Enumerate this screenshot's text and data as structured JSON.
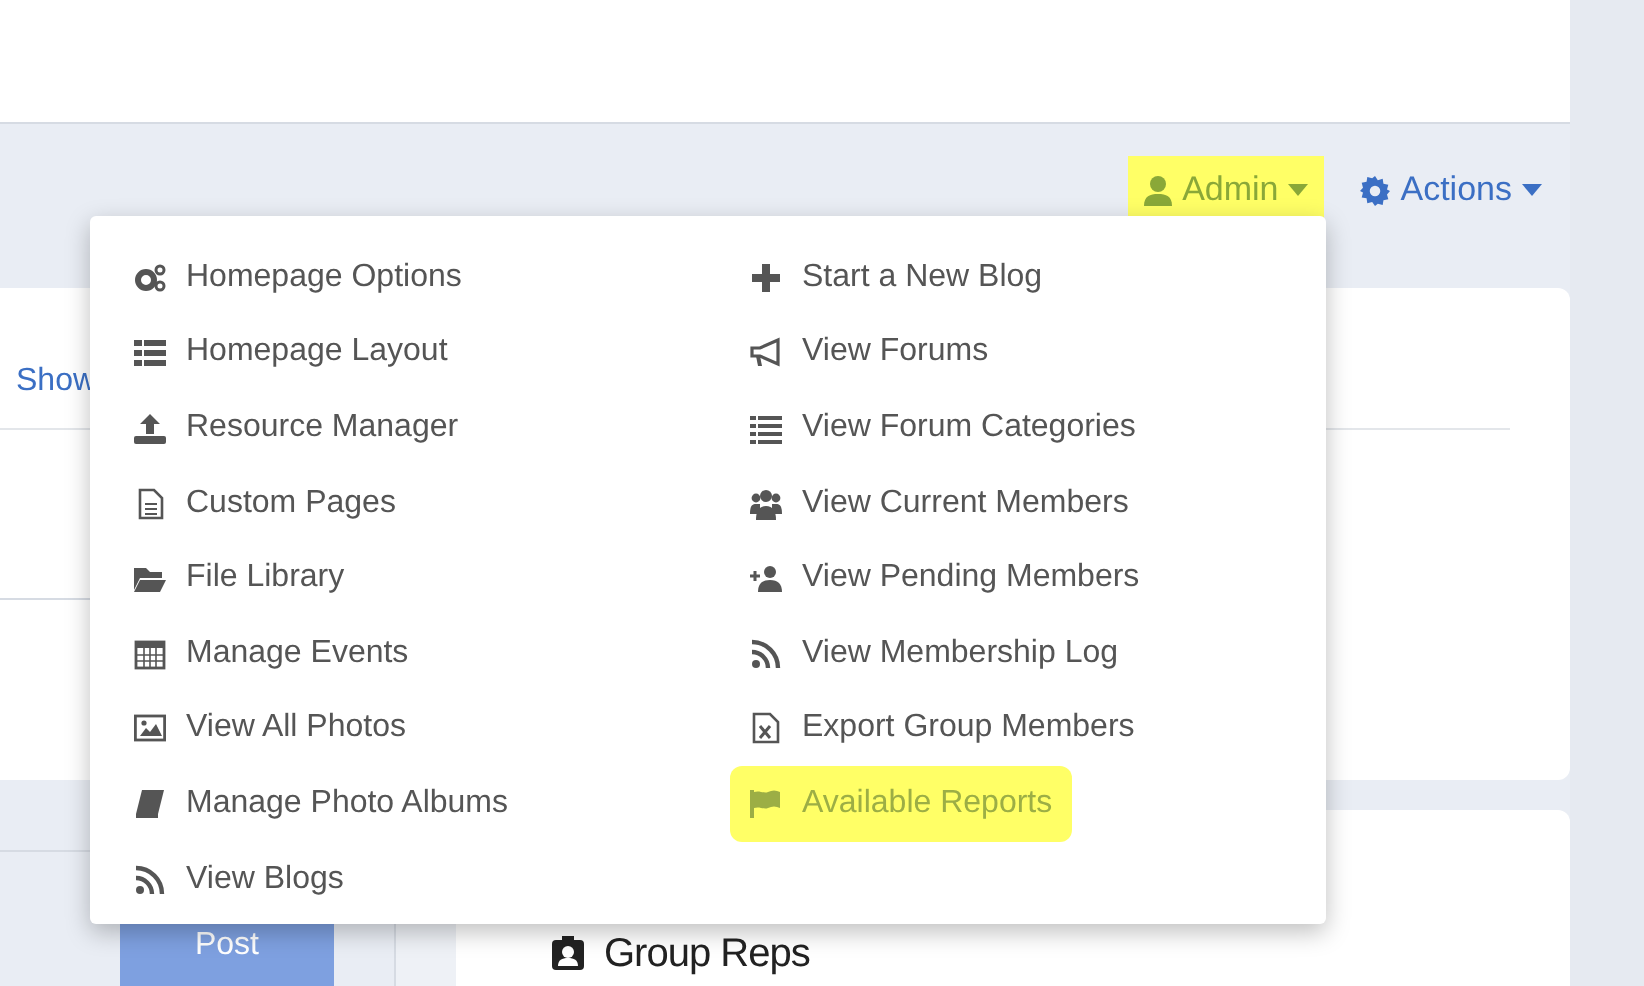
{
  "nav": [
    {
      "kind": "admin",
      "label": "Admin",
      "highlighted": true
    },
    {
      "kind": "actions",
      "label": "Actions",
      "highlighted": false
    }
  ],
  "card": {
    "link": "Show"
  },
  "post_button": "Post",
  "group_reps": {
    "title": "Group Reps"
  },
  "admin_menu": {
    "columns": [
      [
        {
          "label": "Homepage Options",
          "highlighted": false
        },
        {
          "label": "Homepage Layout",
          "highlighted": false
        },
        {
          "label": "Resource Manager",
          "highlighted": false
        },
        {
          "label": "Custom Pages",
          "highlighted": false
        },
        {
          "label": "File Library",
          "highlighted": false
        },
        {
          "label": "Manage Events",
          "highlighted": false
        },
        {
          "label": "View All Photos",
          "highlighted": false
        },
        {
          "label": "Manage Photo Albums",
          "highlighted": false
        },
        {
          "label": "View Blogs",
          "highlighted": false
        }
      ],
      [
        {
          "label": "Start a New Blog",
          "highlighted": false
        },
        {
          "label": "View Forums",
          "highlighted": false
        },
        {
          "label": "View Forum Categories",
          "highlighted": false
        },
        {
          "label": "View Current Members",
          "highlighted": false
        },
        {
          "label": "View Pending Members",
          "highlighted": false
        },
        {
          "label": "View Membership Log",
          "highlighted": false
        },
        {
          "label": "Export Group Members",
          "highlighted": false
        },
        {
          "label": "Available Reports",
          "highlighted": true
        }
      ]
    ]
  }
}
